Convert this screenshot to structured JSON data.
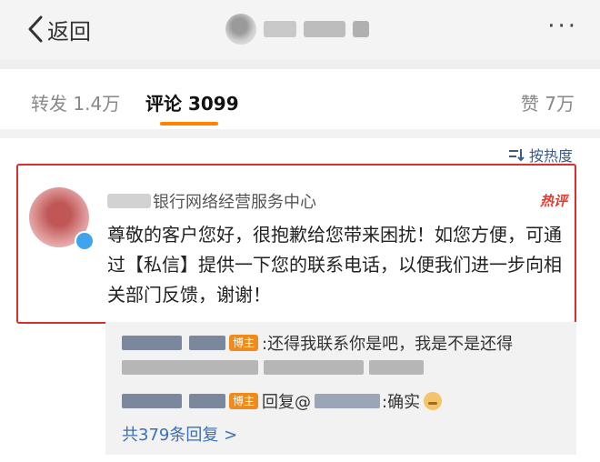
{
  "nav": {
    "back_label": "返回",
    "more_label": "···"
  },
  "tabs": {
    "repost_label": "转发",
    "repost_count": "1.4万",
    "comments_label": "评论",
    "comments_count": "3099",
    "likes_label": "赞",
    "likes_count": "7万"
  },
  "sort": {
    "label": "按热度"
  },
  "comment": {
    "author_name": "银行网络经营服务中心",
    "hot_badge": "热评",
    "text": "尊敬的客户您好，很抱歉给您带来困扰！如您方便，可通过【私信】提供一下您的联系电话，以便我们进一步向相关部门反馈，谢谢！"
  },
  "replies": {
    "badge_label": "博主",
    "reply1_text": ":还得我联系你是吧，我是不是还得",
    "reply3_prefix": "回复@",
    "reply3_text": ":确实",
    "more_label": "共379条回复 >"
  },
  "colors": {
    "accent": "#ff8200",
    "highlight_border": "#d9302c",
    "link": "#3b6fb6"
  }
}
